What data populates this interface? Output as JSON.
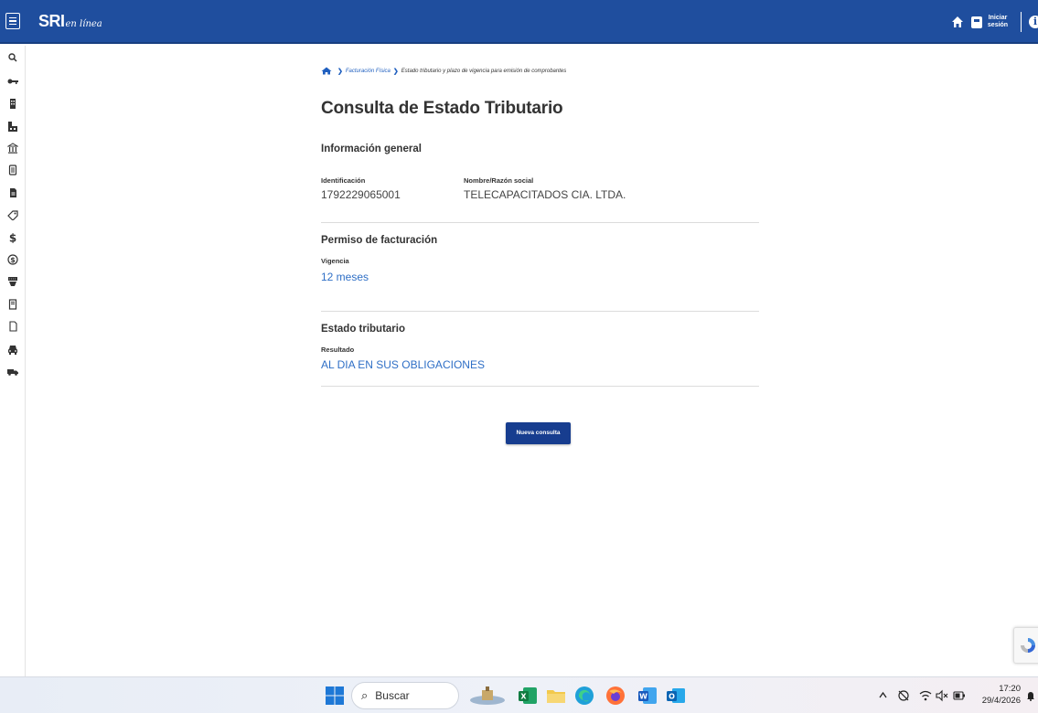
{
  "header": {
    "logo_main": "SRI",
    "logo_sub": "en línea",
    "login_label": "Iniciar sesión",
    "info_glyph": "i"
  },
  "breadcrumb": {
    "items": [
      "Facturación Física",
      "Estado tributario y plazo de vigencia para emisión de comprobantes"
    ]
  },
  "main": {
    "title": "Consulta de Estado Tributario",
    "general": {
      "title": "Información general",
      "id_label": "Identificación",
      "id_value": "1792229065001",
      "name_label": "Nombre/Razón social",
      "name_value": "TELECAPACITADOS CIA. LTDA."
    },
    "permit": {
      "title": "Permiso de facturación",
      "label": "Vigencia",
      "value": "12 meses"
    },
    "status": {
      "title": "Estado tributario",
      "label": "Resultado",
      "value": "AL DIA EN SUS OBLIGACIONES"
    },
    "button_label": "Nueva consulta"
  },
  "sidebar": {
    "icons": [
      "search-icon",
      "key-icon",
      "building-icon",
      "factory-icon",
      "bank-icon",
      "document-icon",
      "file-icon",
      "tag-icon",
      "dollar-icon",
      "coin-icon",
      "payment-icon",
      "receipt-icon",
      "page-icon",
      "car-icon",
      "truck-icon"
    ]
  },
  "taskbar": {
    "search_label": "Buscar",
    "time": "17:20",
    "date": "29/4/2026"
  },
  "colors": {
    "header_bg": "#1f4e9e",
    "button_bg": "#173d8f",
    "link": "#2f6fc6"
  }
}
